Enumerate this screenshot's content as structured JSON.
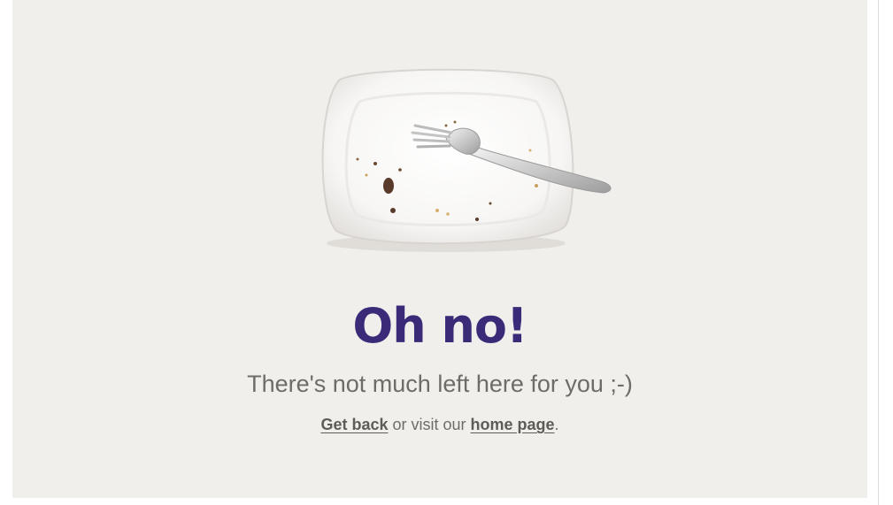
{
  "heading": "Oh no!",
  "subtitle": "There's not much left here for you ;-)",
  "links": {
    "get_back_label": "Get back",
    "middle_text": " or visit our ",
    "home_page_label": "home page",
    "end_text": "."
  },
  "colors": {
    "background": "#f1efec",
    "heading": "#3a2a78",
    "text": "#6e6c69"
  },
  "illustration": {
    "plate_icon": "empty-plate-icon",
    "fork_icon": "fork-icon"
  }
}
